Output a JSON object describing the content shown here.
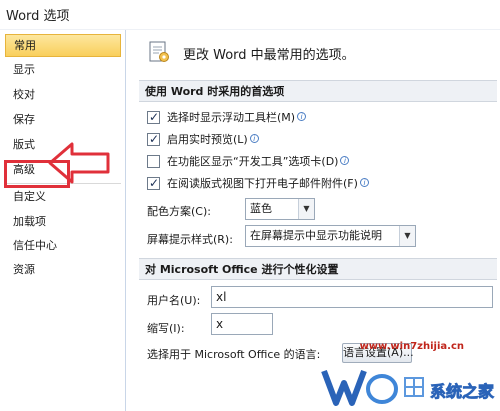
{
  "window": {
    "title": "Word 选项"
  },
  "sidebar": {
    "items": [
      {
        "label": "常用"
      },
      {
        "label": "显示"
      },
      {
        "label": "校对"
      },
      {
        "label": "保存"
      },
      {
        "label": "版式"
      },
      {
        "label": "高级"
      },
      {
        "label": "自定义"
      },
      {
        "label": "加载项"
      },
      {
        "label": "信任中心"
      },
      {
        "label": "资源"
      }
    ],
    "active_index": 0
  },
  "main": {
    "page_title": "更改 Word 中最常用的选项。",
    "section1": {
      "header": "使用 Word 时采用的首选项",
      "options": [
        {
          "label": "选择时显示浮动工具栏(M)",
          "checked": true
        },
        {
          "label": "启用实时预览(L)",
          "checked": true
        },
        {
          "label": "在功能区显示“开发工具”选项卡(D)",
          "checked": false
        },
        {
          "label": "在阅读版式视图下打开电子邮件附件(F)",
          "checked": true
        }
      ],
      "color_scheme": {
        "label": "配色方案(C):",
        "value": "蓝色"
      },
      "tooltip_style": {
        "label": "屏幕提示样式(R):",
        "value": "在屏幕提示中显示功能说明"
      }
    },
    "section2": {
      "header": "对 Microsoft Office 进行个性化设置",
      "username": {
        "label": "用户名(U):",
        "value": "xl"
      },
      "initials": {
        "label": "缩写(I):",
        "value": "x"
      },
      "language_label": "选择用于 Microsoft Office 的语言:",
      "language_button": "语言设置(A)..."
    }
  },
  "watermark": {
    "url": "www.win7zhijia.cn",
    "brand": "系统之家"
  },
  "colors": {
    "active_nav": "#f9cf5c",
    "section_header_bg": "#eef1f5",
    "annotation_red": "#e0303a",
    "sidebar_border": "#c9d6e8"
  }
}
